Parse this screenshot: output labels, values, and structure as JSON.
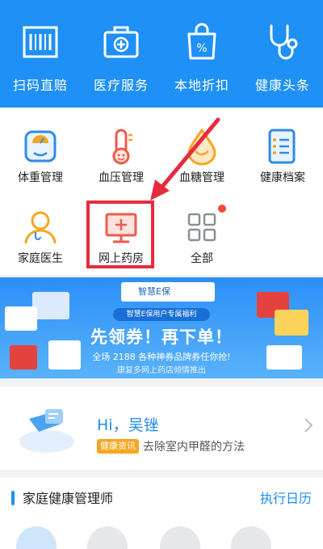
{
  "top_menu": [
    {
      "label": "扫码直赔",
      "icon": "barcode-icon"
    },
    {
      "label": "医疗服务",
      "icon": "medical-kit-icon"
    },
    {
      "label": "本地折扣",
      "icon": "discount-bag-icon"
    },
    {
      "label": "健康头条",
      "icon": "stethoscope-icon"
    }
  ],
  "grid": [
    {
      "label": "体重管理",
      "icon": "scale-icon"
    },
    {
      "label": "血压管理",
      "icon": "thermometer-icon"
    },
    {
      "label": "血糖管理",
      "icon": "blood-drop-icon"
    },
    {
      "label": "健康档案",
      "icon": "file-icon"
    },
    {
      "label": "家庭医生",
      "icon": "doctor-icon"
    },
    {
      "label": "网上药房",
      "icon": "monitor-plus-icon"
    },
    {
      "label": "全部",
      "icon": "grid-icon"
    }
  ],
  "banner": {
    "logo_text": "智慧E保",
    "pill_text": "智慧E保用户专属福利",
    "headline": "先领券！再下单！",
    "subline": "全场 2188 各种神券品牌券任你抢!",
    "note": "康复多网上药店倾情推出"
  },
  "greeting": {
    "hello": "Hi，吴锉",
    "tag": "健康资讯",
    "tip": "去除室内甲醛的方法"
  },
  "section": {
    "title": "家庭健康管理师",
    "link": "执行日历"
  },
  "colors": {
    "brand_blue": "#1e90f6",
    "highlight_red": "#e62b3f",
    "icon_orange": "#f5a623",
    "icon_red": "#ef5a4c"
  }
}
